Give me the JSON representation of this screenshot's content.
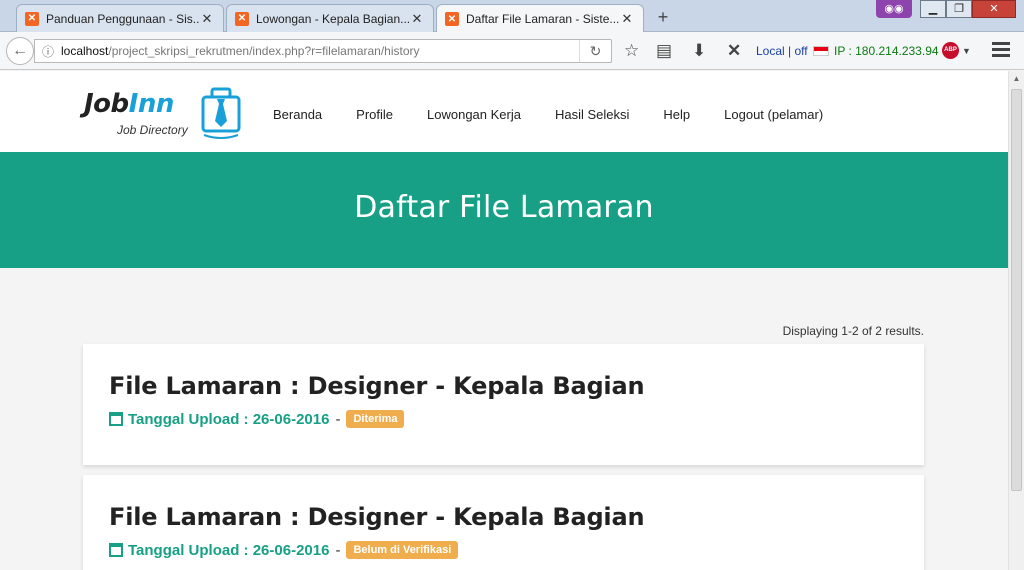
{
  "browser": {
    "tabs": [
      {
        "title": "Panduan Penggunaan - Sis...",
        "active": false
      },
      {
        "title": "Lowongan - Kepala Bagian...",
        "active": false
      },
      {
        "title": "Daftar File Lamaran - Siste...",
        "active": true
      }
    ],
    "url_host": "localhost",
    "url_path": "/project_skripsi_rekrutmen/index.php?r=filelamaran/history",
    "local_status": "Local | off",
    "ip_text": "IP : 180.214.233.94",
    "abp_label": "ABP"
  },
  "site": {
    "logo": {
      "word_a": "Job",
      "word_b": "Inn",
      "tagline": "Job Directory"
    },
    "nav": [
      "Beranda",
      "Profile",
      "Lowongan Kerja",
      "Hasil Seleksi",
      "Help",
      "Logout (pelamar)"
    ],
    "hero_title": "Daftar File Lamaran",
    "summary": "Displaying 1-2 of 2 results.",
    "items": [
      {
        "title": "File Lamaran : Designer - Kepala Bagian",
        "date_label": "Tanggal Upload : 26-06-2016",
        "separator": "-",
        "status": "Diterima"
      },
      {
        "title": "File Lamaran : Designer - Kepala Bagian",
        "date_label": "Tanggal Upload : 26-06-2016",
        "separator": "-",
        "status": "Belum di Verifikasi"
      }
    ]
  },
  "colors": {
    "accent": "#17a085",
    "badge": "#f0ad4e",
    "logo_blue": "#1aa0d8"
  }
}
